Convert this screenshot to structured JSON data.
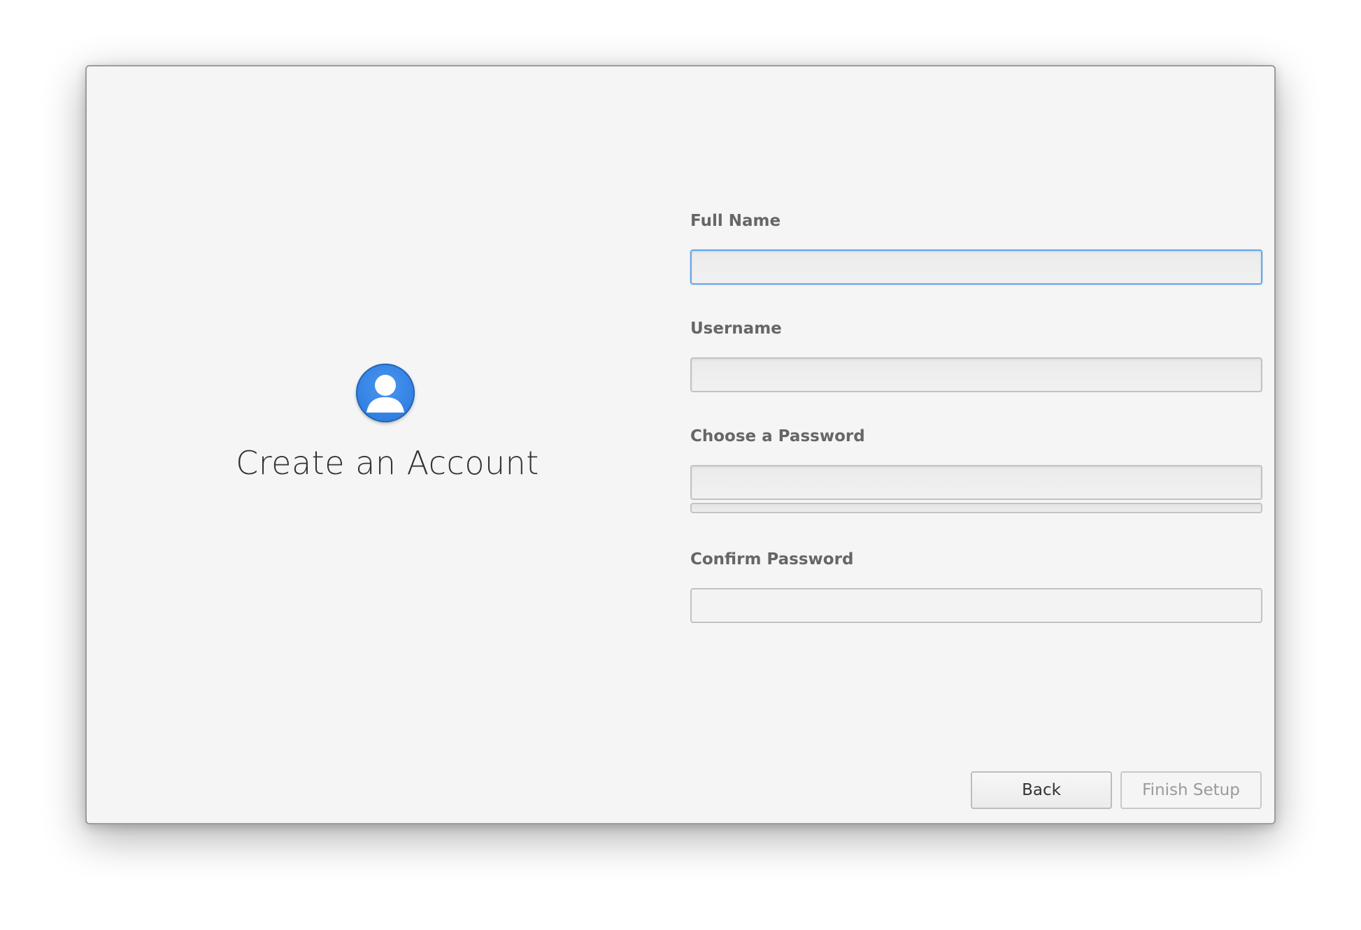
{
  "page": {
    "title": "Create an Account"
  },
  "form": {
    "full_name": {
      "label": "Full Name",
      "value": "",
      "placeholder": ""
    },
    "username": {
      "label": "Username",
      "value": "",
      "placeholder": ""
    },
    "password": {
      "label": "Choose a Password",
      "value": "",
      "placeholder": "",
      "strength": 0
    },
    "confirm_password": {
      "label": "Confirm Password",
      "value": "",
      "placeholder": ""
    }
  },
  "buttons": {
    "back_label": "Back",
    "finish_label": "Finish Setup"
  },
  "icons": {
    "avatar": "user-avatar-icon"
  },
  "colors": {
    "accent": "#3483e4",
    "focus_border": "#6aa8ea",
    "window_bg": "#f5f5f5"
  }
}
